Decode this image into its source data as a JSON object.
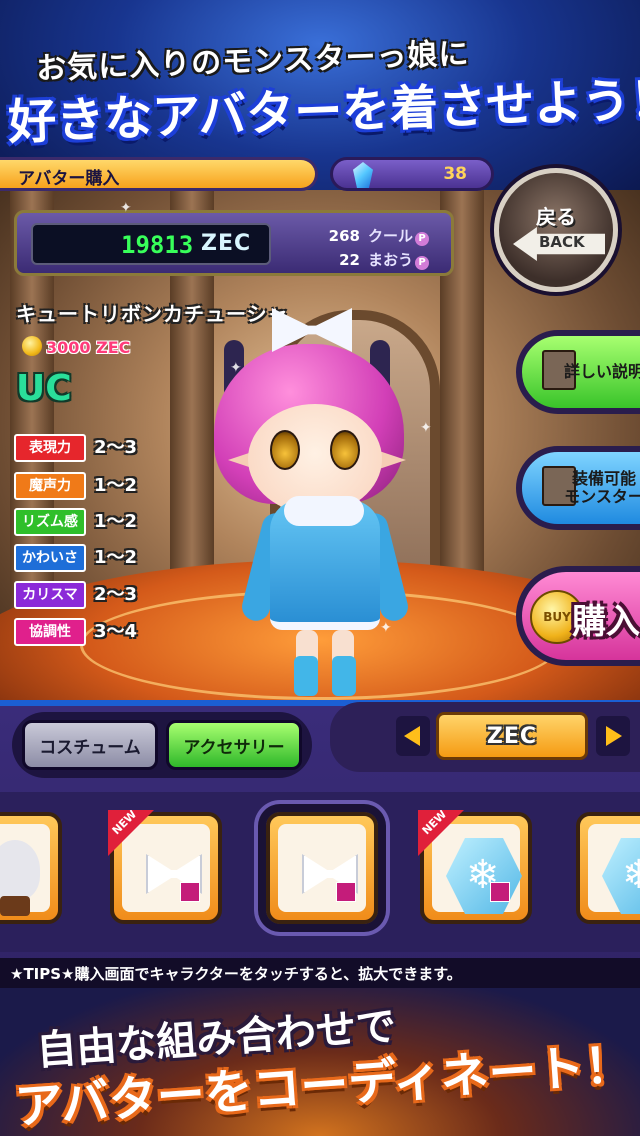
{
  "promo": {
    "top_line1": "お気に入りのモンスターっ娘に",
    "top_line2": "好きなアバターを着させよう！",
    "bottom_line1": "自由な組み合わせで",
    "bottom_line2": "アバターをコーディネート！"
  },
  "header": {
    "title": "アバター購入",
    "gems": "38",
    "zec_amount": "19813",
    "zec_label": "ZEC",
    "cool_points": "268",
    "cool_label": "クール",
    "maou_points": "22",
    "maou_label": "まおう",
    "point_icon": "P"
  },
  "back_button": {
    "label_jp": "戻る",
    "label_en": "BACK"
  },
  "item": {
    "name": "キュートリボンカチューシャ",
    "price": "3000 ZEC",
    "rarity": "UC",
    "stats": [
      {
        "label": "表現力",
        "value": "2〜3",
        "color": "#e6262c"
      },
      {
        "label": "魔声力",
        "value": "1〜2",
        "color": "#f07a18"
      },
      {
        "label": "リズム感",
        "value": "1〜2",
        "color": "#2fbf2a"
      },
      {
        "label": "かわいさ",
        "value": "1〜2",
        "color": "#1e6ed8"
      },
      {
        "label": "カリスマ",
        "value": "2〜3",
        "color": "#8b2ad8"
      },
      {
        "label": "協調性",
        "value": "3〜4",
        "color": "#e0208c"
      }
    ]
  },
  "side_buttons": {
    "details": "詳しい説明",
    "equip_line1": "装備可能",
    "equip_line2": "モンスター",
    "buy_coin": "BUY",
    "buy": "購入"
  },
  "tabs": {
    "costume": "コスチューム",
    "accessory": "アクセサリー",
    "active": "accessory"
  },
  "filter": {
    "current": "ZEC"
  },
  "items": [
    {
      "name": "bust-stand",
      "new": false
    },
    {
      "name": "white-ribbon",
      "new": true,
      "new_label": "NEW"
    },
    {
      "name": "white-ribbon",
      "new": false,
      "selected": true
    },
    {
      "name": "snowflake",
      "new": true,
      "new_label": "NEW"
    },
    {
      "name": "snowflake",
      "new": false
    }
  ],
  "tips": "★TIPS★購入画面でキャラクターをタッチすると、拡大できます。",
  "colors": {
    "accent": "#1b5fd4",
    "price": "#ff3a7a",
    "digital": "#38ff5a"
  }
}
